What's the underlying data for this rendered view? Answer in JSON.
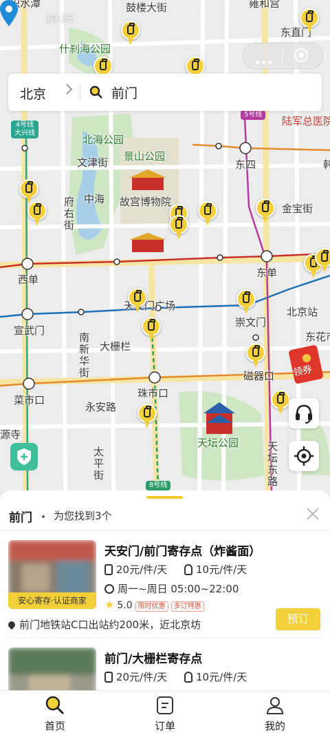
{
  "status_bar": {
    "time": "10:33"
  },
  "search": {
    "city": "北京",
    "query": "前门"
  },
  "map": {
    "labels": {
      "gulou": "鼓楼大街",
      "yonghe": "雍和宫",
      "jishuitan": "积水潭",
      "shichahai": "什刹海公园",
      "dongzhi": "东直门",
      "luzong": "陆军总医院",
      "beihai": "北海公园",
      "jingshan": "景山公园",
      "wenjin": "文津街",
      "dongsi": "东四",
      "zhonghai": "中海",
      "gugong": "故宫博物院",
      "fuyou": "府右街",
      "jinbao": "金宝街",
      "xidan": "西单",
      "dongdan": "东单",
      "beijingzhan": "北京站",
      "tiananmen": "天安门广场",
      "xuanwumen": "宣武门",
      "chongwenmen": "崇文门",
      "dongbian": "东花市",
      "nanxinhua": "南新华街",
      "dashilan": "大栅栏",
      "ciqikou": "磁器口",
      "caishikou": "菜市口",
      "zhushikou": "珠市口",
      "yongan": "永安路",
      "yuan": "源寺",
      "taipingjie": "太平街",
      "tiantan": "天坛公园",
      "tiantandong": "天坛东路",
      "han": "韩"
    },
    "lines": {
      "line4": "4号线",
      "line4b": "大兴线",
      "line5": "5号线",
      "line8": "8号线"
    },
    "coupon_label": "领券"
  },
  "sheet": {
    "query": "前门",
    "found_text": "为您找到3个",
    "cards": [
      {
        "name": "天安门/前门寄存点（炸酱面）",
        "price_large": "20元/件/天",
        "price_small": "10元/件/天",
        "hours": "周一~周日 05:00~22:00",
        "rating": "5.0",
        "badges": [
          "限时优惠",
          "多订特惠"
        ],
        "tag": "安心寄存·认证商家",
        "address": "前门地铁站C口出站约200米，近北京坊",
        "book_label": "预订"
      },
      {
        "name": "前门/大栅栏寄存点",
        "price_large": "20元/件/天",
        "price_small": "10元/件/天"
      }
    ]
  },
  "tabs": [
    {
      "label": "首页",
      "icon": "search-icon"
    },
    {
      "label": "订单",
      "icon": "order-icon"
    },
    {
      "label": "我的",
      "icon": "user-icon"
    }
  ],
  "colors": {
    "accent": "#f3cf3a",
    "line_red": "#c8302b",
    "line_blue": "#1d6fb8",
    "line_orange": "#e58a2a",
    "line_teal": "#2aa58f"
  }
}
